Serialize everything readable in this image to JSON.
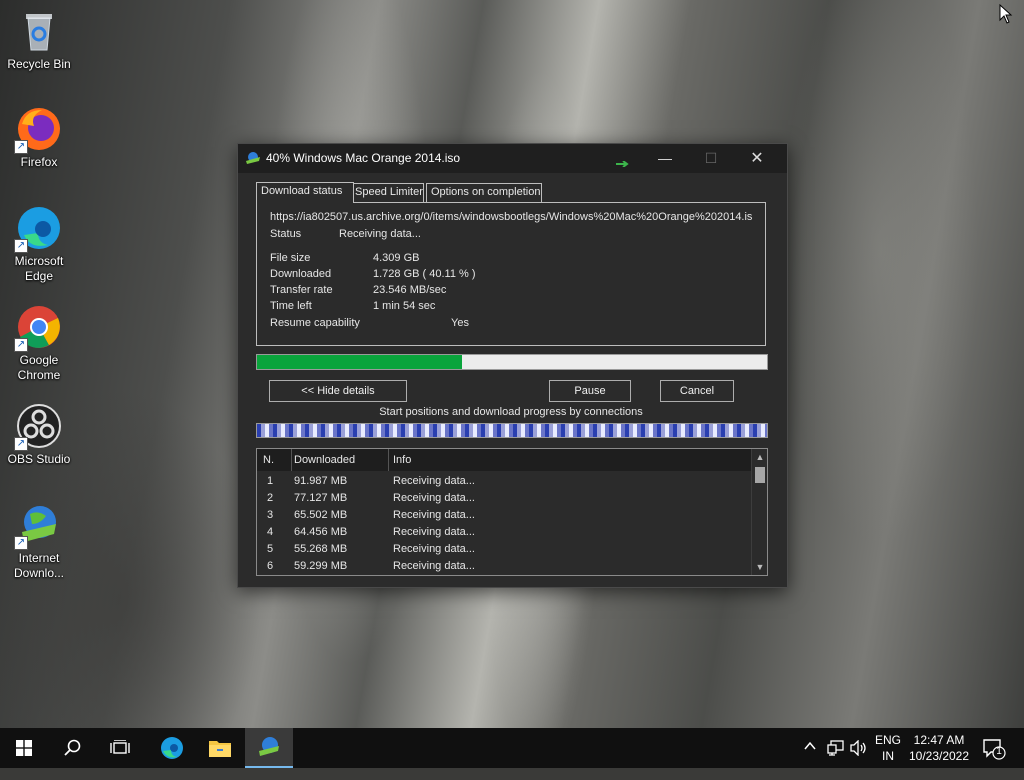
{
  "desktop": {
    "icons": [
      {
        "label": "Recycle Bin"
      },
      {
        "label": "Firefox"
      },
      {
        "label": "Microsoft Edge"
      },
      {
        "label": "Google Chrome"
      },
      {
        "label": "OBS Studio"
      },
      {
        "label": "Internet Downlo..."
      }
    ]
  },
  "window": {
    "title": "40% Windows Mac Orange 2014.iso",
    "tabs": [
      "Download status",
      "Speed Limiter",
      "Options on completion"
    ],
    "url": "https://ia802507.us.archive.org/0/items/windowsbootlegs/Windows%20Mac%20Orange%202014.is",
    "status_label": "Status",
    "status_value": "Receiving data...",
    "file_size_label": "File size",
    "file_size_value": "4.309  GB",
    "downloaded_label": "Downloaded",
    "downloaded_value": "1.728  GB  ( 40.11 % )",
    "transfer_rate_label": "Transfer rate",
    "transfer_rate_value": "23.546  MB/sec",
    "time_left_label": "Time left",
    "time_left_value": "1 min 54 sec",
    "resume_label": "Resume capability",
    "resume_value": "Yes",
    "progress_percent": 40.11,
    "hide_details_label": "<< Hide details",
    "pause_label": "Pause",
    "cancel_label": "Cancel",
    "connections_label": "Start positions and download progress by connections",
    "table": {
      "columns": [
        "N.",
        "Downloaded",
        "Info"
      ],
      "rows": [
        {
          "n": "1",
          "downloaded": "91.987  MB",
          "info": "Receiving data..."
        },
        {
          "n": "2",
          "downloaded": "77.127  MB",
          "info": "Receiving data..."
        },
        {
          "n": "3",
          "downloaded": "65.502  MB",
          "info": "Receiving data..."
        },
        {
          "n": "4",
          "downloaded": "64.456  MB",
          "info": "Receiving data..."
        },
        {
          "n": "5",
          "downloaded": "55.268  MB",
          "info": "Receiving data..."
        },
        {
          "n": "6",
          "downloaded": "59.299  MB",
          "info": "Receiving data..."
        }
      ]
    }
  },
  "taskbar": {
    "language_top": "ENG",
    "language_bottom": "IN",
    "time": "12:47 AM",
    "date": "10/23/2022",
    "notification_count": "1"
  }
}
